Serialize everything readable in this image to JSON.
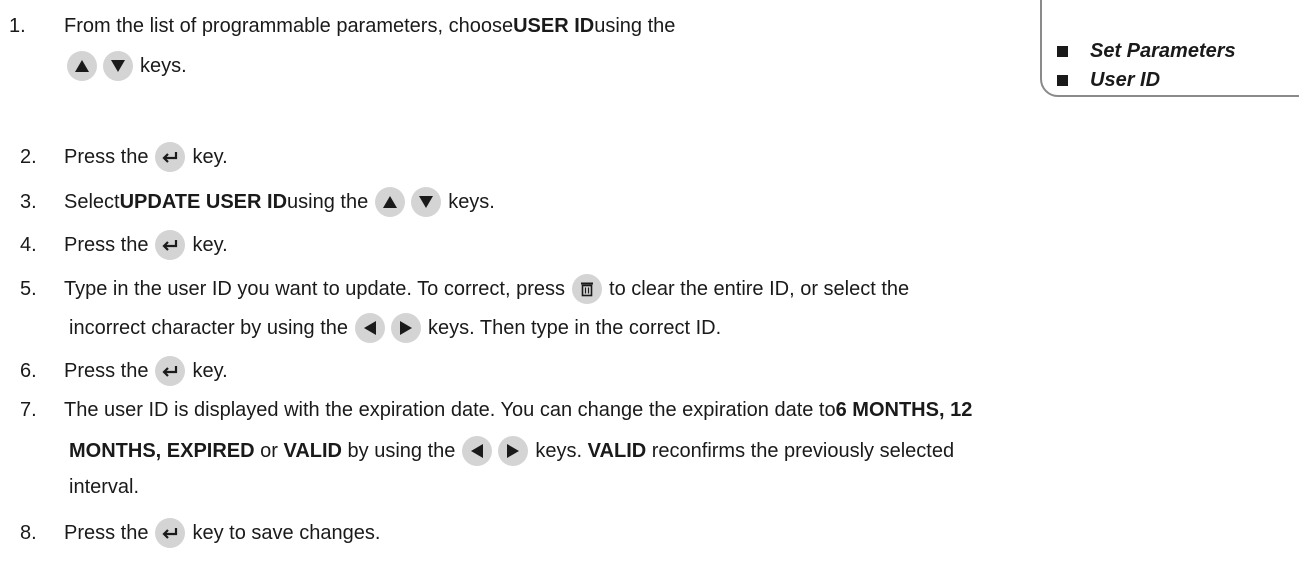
{
  "sidebar": {
    "items": [
      {
        "label": "Set Parameters"
      },
      {
        "label": "User ID"
      }
    ]
  },
  "steps": {
    "s1": {
      "num": "1.",
      "a": "From the list of programmable parameters, choose ",
      "b": "USER ID",
      "c": " using the",
      "d": "keys."
    },
    "s2": {
      "num": "2.",
      "a": "Press the",
      "b": "key."
    },
    "s3": {
      "num": "3.",
      "a": "Select ",
      "b": "UPDATE USER ID",
      "c": " using the",
      "d": "keys."
    },
    "s4": {
      "num": "4.",
      "a": "Press the",
      "b": "key."
    },
    "s5": {
      "num": "5.",
      "a": "Type in the user ID you want to update. To correct, press",
      "b": "to clear the entire ID, or select the",
      "c": "incorrect character by using the",
      "d": "keys. Then type in the correct ID."
    },
    "s6": {
      "num": "6.",
      "a": "Press the",
      "b": "key."
    },
    "s7": {
      "num": "7.",
      "a": "The user ID is displayed with the expiration date. You can change the expiration date to ",
      "b": "6 MONTHS, 12",
      "c": "MONTHS, EXPIRED",
      "d": " or ",
      "e": "VALID",
      "f": " by using the",
      "g": "keys. ",
      "h": "VALID",
      "i": " reconfirms the previously selected",
      "j": "interval."
    },
    "s8": {
      "num": "8.",
      "a": "Press the",
      "b": "key to save changes."
    }
  },
  "icons": {
    "key_bg": "#d4d4d4",
    "glyph": "#1a1a1a"
  }
}
